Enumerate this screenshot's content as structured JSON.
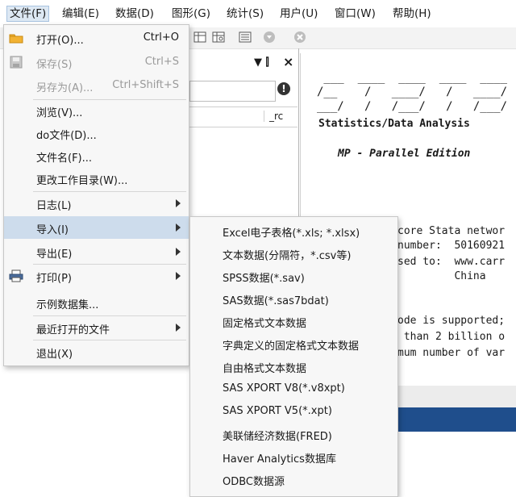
{
  "menubar": {
    "items": [
      {
        "label": "文件(F)"
      },
      {
        "label": "编辑(E)"
      },
      {
        "label": "数据(D)"
      },
      {
        "label": "图形(G)"
      },
      {
        "label": "统计(S)"
      },
      {
        "label": "用户(U)"
      },
      {
        "label": "窗口(W)"
      },
      {
        "label": "帮助(H)"
      }
    ]
  },
  "pane": {
    "pin_glyph": "▼ ⫿",
    "close_glyph": "×",
    "warning_glyph": "!",
    "column_label": "_rc"
  },
  "results": {
    "logo_lines": [
      " ___  ____  ____  ____  ____ (",
      "/__    /   ____/   /   ____/",
      "___/   /   /___/   /   /___/"
    ],
    "subtitle": "Statistics/Data Analysis",
    "edition": "MP - Parallel Edition",
    "lines": [
      "core Stata networ",
      "number:  50160921",
      "sed to:  www.carr",
      "         China",
      "",
      "ode is supported;",
      " than 2 billion o",
      "mum number of var"
    ]
  },
  "file_menu": {
    "items": [
      {
        "label": "打开(O)...",
        "shortcut": "Ctrl+O"
      },
      {
        "label": "保存(S)",
        "shortcut": "Ctrl+S"
      },
      {
        "label": "另存为(A)...",
        "shortcut": "Ctrl+Shift+S"
      },
      {
        "label": "浏览(V)..."
      },
      {
        "label": "do文件(D)..."
      },
      {
        "label": "文件名(F)..."
      },
      {
        "label": "更改工作目录(W)..."
      },
      {
        "label": "日志(L)"
      },
      {
        "label": "导入(I)"
      },
      {
        "label": "导出(E)"
      },
      {
        "label": "打印(P)"
      },
      {
        "label": "示例数据集..."
      },
      {
        "label": "最近打开的文件"
      },
      {
        "label": "退出(X)"
      }
    ]
  },
  "import_submenu": {
    "items": [
      {
        "label": "Excel电子表格(*.xls; *.xlsx)"
      },
      {
        "label": "文本数据(分隔符，*.csv等)"
      },
      {
        "label": "SPSS数据(*.sav)"
      },
      {
        "label": "SAS数据(*.sas7bdat)"
      },
      {
        "label": "固定格式文本数据"
      },
      {
        "label": "字典定义的固定格式文本数据"
      },
      {
        "label": "自由格式文本数据"
      },
      {
        "label": "SAS XPORT V8(*.v8xpt)"
      },
      {
        "label": "SAS XPORT V5(*.xpt)"
      },
      {
        "label": "美联储经济数据(FRED)"
      },
      {
        "label": "Haver Analytics数据库"
      },
      {
        "label": "ODBC数据源"
      }
    ]
  }
}
